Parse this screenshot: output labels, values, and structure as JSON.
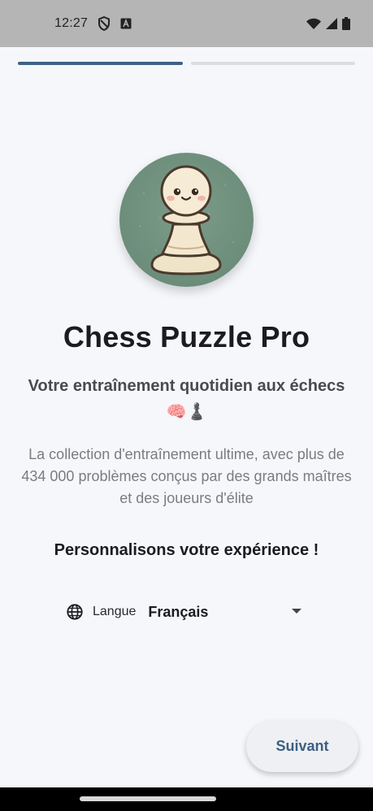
{
  "status_bar": {
    "time": "12:27",
    "icons": [
      "shield-icon",
      "font-a-icon",
      "wifi-icon",
      "signal-icon",
      "battery-icon"
    ]
  },
  "progress": {
    "steps_total": 2,
    "current_step": 1,
    "active_color": "#3d6287"
  },
  "app": {
    "title": "Chess Puzzle Pro",
    "subtitle_line1": "Votre entraînement quotidien aux échecs",
    "subtitle_emojis": "🧠♟️",
    "description": "La collection d'entraînement ultime, avec plus de 434 000 problèmes conçus par des grands maîtres et des joueurs d'élite",
    "personalize": "Personnalisons votre expérience !"
  },
  "language": {
    "label": "Langue",
    "selected": "Français"
  },
  "footer": {
    "next_label": "Suivant"
  },
  "colors": {
    "accent": "#3d6287",
    "button_text": "#3d5f82",
    "logo_bg": "#6c8d7a",
    "background": "#f6f7fb"
  }
}
